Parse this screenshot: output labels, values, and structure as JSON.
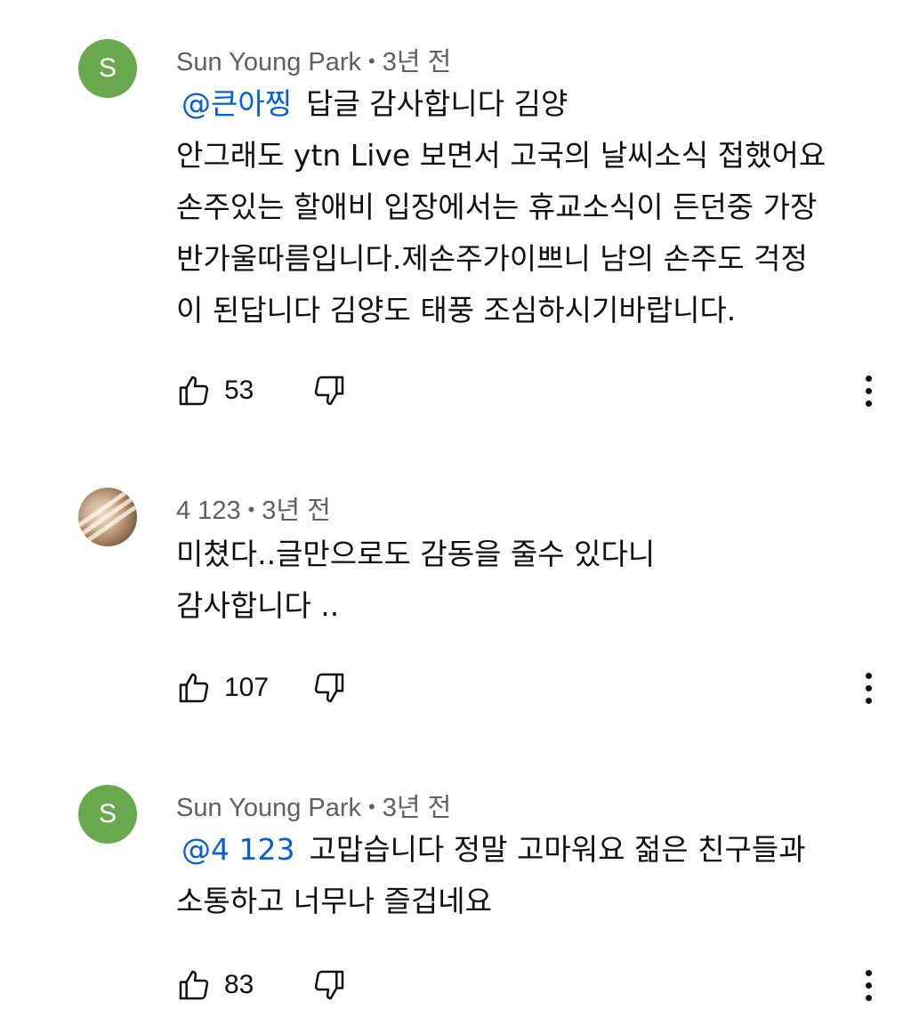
{
  "comments": [
    {
      "author": "Sun Young Park",
      "separator": "•",
      "time": "3년 전",
      "avatar_letter": "S",
      "avatar_color": "#6aa84f",
      "mention": "@큰아찡",
      "first_line_rest": "답글 감사합니다 김양",
      "lines": [
        "안그래도 ytn Live 보면서 고국의 날씨소식 접했어요",
        "손주있는 할애비 입장에서는 휴교소식이 든던중 가장",
        "반가울따름입니다.제손주가이쁘니 남의 손주도 걱정",
        "이 된답니다 김양도 태풍 조심하시기바랍니다."
      ],
      "likes": "53"
    },
    {
      "author": "4 123",
      "separator": "•",
      "time": "3년 전",
      "lines": [
        "미쳤다..글만으로도 감동을 줄수 있다니",
        "감사합니다 .."
      ],
      "likes": "107"
    },
    {
      "author": "Sun Young Park",
      "separator": "•",
      "time": "3년 전",
      "avatar_letter": "S",
      "avatar_color": "#6aa84f",
      "mention": "@4 123",
      "first_line_rest": "고맙습니다 정말 고마워요 젊은 친구들과",
      "lines": [
        "소통하고 너무나 즐겁네요"
      ],
      "likes": "83"
    }
  ],
  "colors": {
    "mention": "#065fd4",
    "meta": "#606060",
    "text": "#0f0f0f"
  },
  "icons": {
    "like": "thumb-up-icon",
    "dislike": "thumb-down-icon",
    "more": "more-vertical-icon"
  }
}
